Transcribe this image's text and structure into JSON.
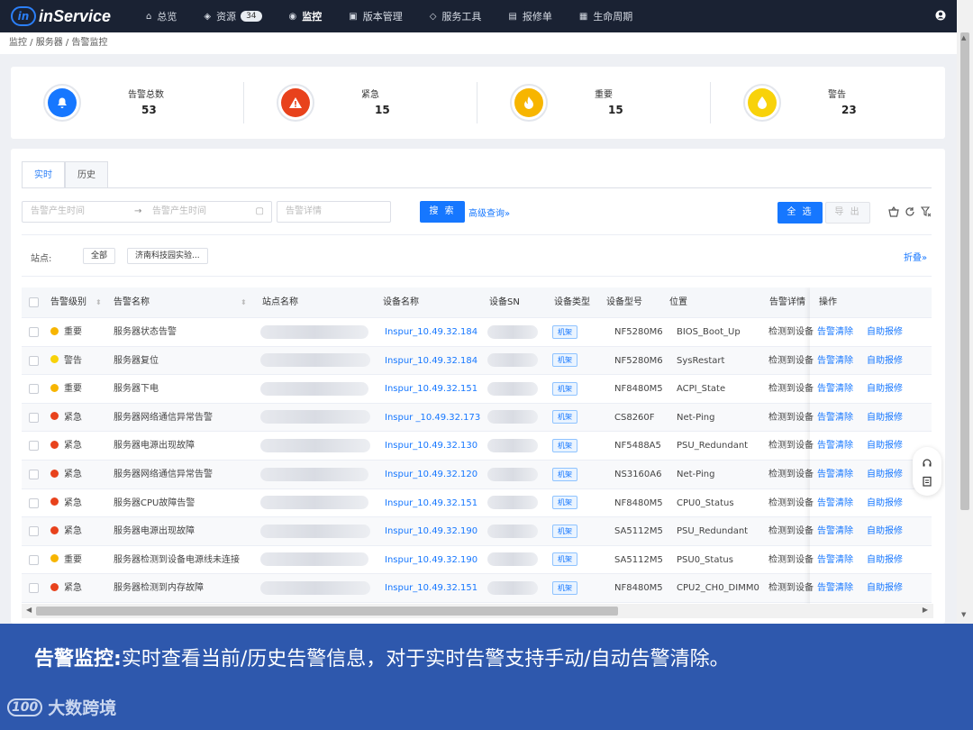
{
  "app": {
    "name": "inService",
    "logo_mark": "in"
  },
  "nav": [
    {
      "label": "总览",
      "icon": "home-icon",
      "glyph": "⌂"
    },
    {
      "label": "资源",
      "icon": "layers-icon",
      "glyph": "◈",
      "badge": "34"
    },
    {
      "label": "监控",
      "icon": "monitor-icon",
      "glyph": "◉",
      "active": true
    },
    {
      "label": "版本管理",
      "icon": "version-icon",
      "glyph": "▣"
    },
    {
      "label": "服务工具",
      "icon": "tools-icon",
      "glyph": "◇"
    },
    {
      "label": "报修单",
      "icon": "ticket-icon",
      "glyph": "▤"
    },
    {
      "label": "生命周期",
      "icon": "lifecycle-icon",
      "glyph": "▦"
    }
  ],
  "breadcrumb": "监控 / 服务器 / 告警监控",
  "stats": [
    {
      "label": "告警总数",
      "value": "53",
      "color": "#1677ff",
      "icon": "bell-icon",
      "glyph": "🔔"
    },
    {
      "label": "紧急",
      "value": "15",
      "color": "#e8421c",
      "icon": "warning-icon",
      "glyph": "!"
    },
    {
      "label": "重要",
      "value": "15",
      "color": "#f7b500",
      "icon": "fire-icon",
      "glyph": "♨"
    },
    {
      "label": "警告",
      "value": "23",
      "color": "#f8d20a",
      "icon": "drop-icon",
      "glyph": "●"
    }
  ],
  "tabs": [
    {
      "label": "实时",
      "active": true
    },
    {
      "label": "历史"
    }
  ],
  "filters": {
    "start_placeholder": "告警产生时间",
    "end_placeholder": "告警产生时间",
    "detail_placeholder": "告警详情",
    "search_label": "搜 索",
    "advanced_label": "高级查询",
    "select_all_label": "全 选",
    "export_label": "导 出",
    "site_label": "站点:",
    "site_all": "全部",
    "site_option": "济南科技园实验...",
    "fold_label": "折叠"
  },
  "table": {
    "columns": [
      "告警级别",
      "告警名称",
      "站点名称",
      "设备名称",
      "设备SN",
      "设备类型",
      "设备型号",
      "位置",
      "告警详情",
      "操作"
    ],
    "clear_label": "告警清除",
    "report_label": "自助报修",
    "rows": [
      {
        "level": "重要",
        "level_color": "#f7b500",
        "name": "服务器状态告警",
        "device": "Inspur_10.49.32.184",
        "type": "机架",
        "model": "NF5280M6",
        "location": "BIOS_Boot_Up",
        "detail": "检测到设备"
      },
      {
        "level": "警告",
        "level_color": "#f8d20a",
        "name": "服务器复位",
        "device": "Inspur_10.49.32.184",
        "type": "机架",
        "model": "NF5280M6",
        "location": "SysRestart",
        "detail": "检测到设备"
      },
      {
        "level": "重要",
        "level_color": "#f7b500",
        "name": "服务器下电",
        "device": "Inspur_10.49.32.151",
        "type": "机架",
        "model": "NF8480M5",
        "location": "ACPI_State",
        "detail": "检测到设备"
      },
      {
        "level": "紧急",
        "level_color": "#e8421c",
        "name": "服务器网络通信异常告警",
        "device": "Inspur _10.49.32.173",
        "type": "机架",
        "model": "CS8260F",
        "location": "Net-Ping",
        "detail": "检测到设备"
      },
      {
        "level": "紧急",
        "level_color": "#e8421c",
        "name": "服务器电源出现故障",
        "device": "Inspur_10.49.32.130",
        "type": "机架",
        "model": "NF5488A5",
        "location": "PSU_Redundant",
        "detail": "检测到设备"
      },
      {
        "level": "紧急",
        "level_color": "#e8421c",
        "name": "服务器网络通信异常告警",
        "device": "Inspur_10.49.32.120",
        "type": "机架",
        "model": "NS3160A6",
        "location": "Net-Ping",
        "detail": "检测到设备"
      },
      {
        "level": "紧急",
        "level_color": "#e8421c",
        "name": "服务器CPU故障告警",
        "device": "Inspur_10.49.32.151",
        "type": "机架",
        "model": "NF8480M5",
        "location": "CPU0_Status",
        "detail": "检测到设备"
      },
      {
        "level": "紧急",
        "level_color": "#e8421c",
        "name": "服务器电源出现故障",
        "device": "Inspur_10.49.32.190",
        "type": "机架",
        "model": "SA5112M5",
        "location": "PSU_Redundant",
        "detail": "检测到设备"
      },
      {
        "level": "重要",
        "level_color": "#f7b500",
        "name": "服务器检测到设备电源线未连接",
        "device": "Inspur_10.49.32.190",
        "type": "机架",
        "model": "SA5112M5",
        "location": "PSU0_Status",
        "detail": "检测到设备"
      },
      {
        "level": "紧急",
        "level_color": "#e8421c",
        "name": "服务器检测到内存故障",
        "device": "Inspur_10.49.32.151",
        "type": "机架",
        "model": "NF8480M5",
        "location": "CPU2_CH0_DIMM0",
        "detail": "检测到设备"
      }
    ]
  },
  "banner": {
    "title": "告警监控:",
    "text": "实时查看当前/历史告警信息，对于实时告警支持手动/自动告警清除。"
  },
  "footer_logo": {
    "mark": "100",
    "text": "大数跨境"
  }
}
